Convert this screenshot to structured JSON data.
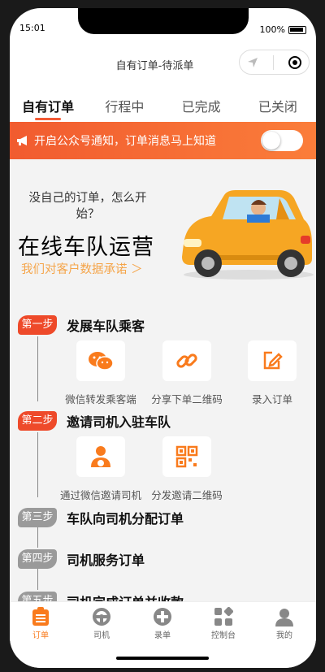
{
  "status": {
    "time": "15:01",
    "battery": "100%"
  },
  "nav": {
    "title": "自有订单-待派单"
  },
  "tabs": [
    "自有订单",
    "行程中",
    "已完成",
    "已关闭"
  ],
  "notice": {
    "text": "开启公众号通知，订单消息马上知道"
  },
  "hero": {
    "question": "没自己的订单，怎么开始？",
    "title": "在线车队运营",
    "subtitle": "我们对客户数据承诺 ＞"
  },
  "steps": [
    {
      "badge": "第一步",
      "text": "发展车队乘客"
    },
    {
      "badge": "第二步",
      "text": "邀请司机入驻车队"
    },
    {
      "badge": "第三步",
      "text": "车队向司机分配订单"
    },
    {
      "badge": "第四步",
      "text": "司机服务订单"
    },
    {
      "badge": "第五步",
      "text": "司机完成订单并收款"
    }
  ],
  "step1_actions": [
    {
      "label": "微信转发乘客端",
      "icon": "wechat-icon"
    },
    {
      "label": "分享下单二维码",
      "icon": "link-icon"
    },
    {
      "label": "录入订单",
      "icon": "edit-icon"
    }
  ],
  "step2_actions": [
    {
      "label": "通过微信邀请司机",
      "icon": "driver-icon"
    },
    {
      "label": "分发邀请二维码",
      "icon": "qrcode-icon"
    }
  ],
  "tabbar": [
    {
      "label": "订单",
      "icon": "clipboard-icon",
      "active": true
    },
    {
      "label": "司机",
      "icon": "steering-wheel-icon",
      "active": false
    },
    {
      "label": "录单",
      "icon": "plus-circle-icon",
      "active": false
    },
    {
      "label": "控制台",
      "icon": "dashboard-icon",
      "active": false
    },
    {
      "label": "我的",
      "icon": "user-icon",
      "active": false
    }
  ],
  "colors": {
    "accent": "#f35a35",
    "orange": "#f97b1d",
    "hint": "#f5a54a"
  }
}
